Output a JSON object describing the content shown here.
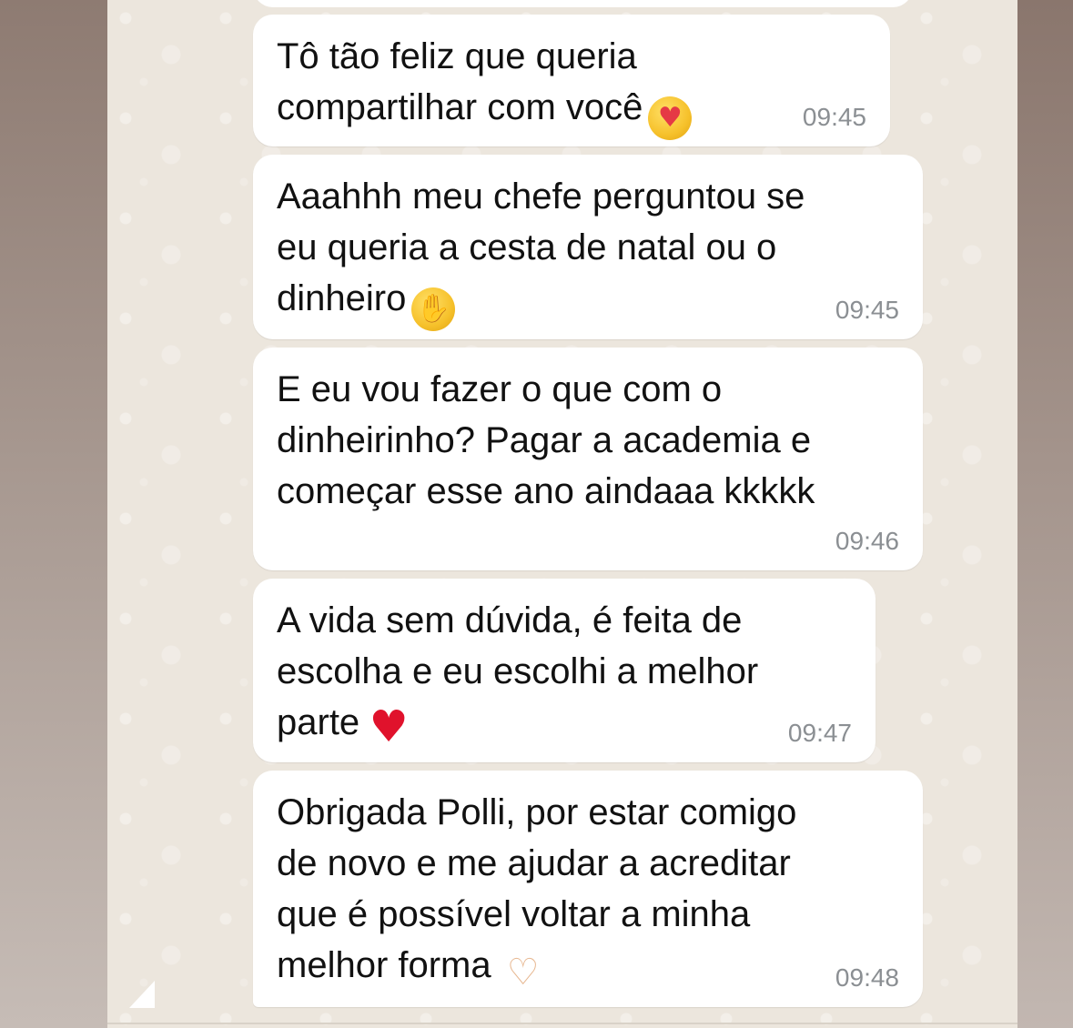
{
  "chat": {
    "messages": [
      {
        "text": "Tô tão feliz que queria\ncompartilhar com você",
        "emoji": "😍",
        "emoji_name": "smiling-face-with-heart-eyes",
        "time": "09:45"
      },
      {
        "text": "Aaahhh meu chefe perguntou se\neu queria a cesta de natal ou o\ndinheiro",
        "emoji": "🤭",
        "emoji_name": "face-with-hand-over-mouth",
        "time": "09:45"
      },
      {
        "text": "E eu vou fazer o que com o\ndinheirinho? Pagar a academia e\ncomeçar esse ano aindaaa kkkkk",
        "emoji": "",
        "emoji_name": "",
        "time": "09:46"
      },
      {
        "text": "A vida sem dúvida, é feita de\nescolha e eu escolhi a melhor\nparte",
        "emoji": "❤",
        "emoji_name": "red-heart",
        "time": "09:47"
      },
      {
        "text": "Obrigada Polli, por estar comigo\nde novo e me ajudar a acreditar\nque é possível voltar a minha\nmelhor forma",
        "emoji": "🫶",
        "emoji_name": "heart-hands",
        "time": "09:48"
      }
    ]
  },
  "colors": {
    "chat_background": "#ece6dd",
    "bubble_background": "#ffffff",
    "timestamp": "#8b8f93",
    "text": "#111111"
  }
}
